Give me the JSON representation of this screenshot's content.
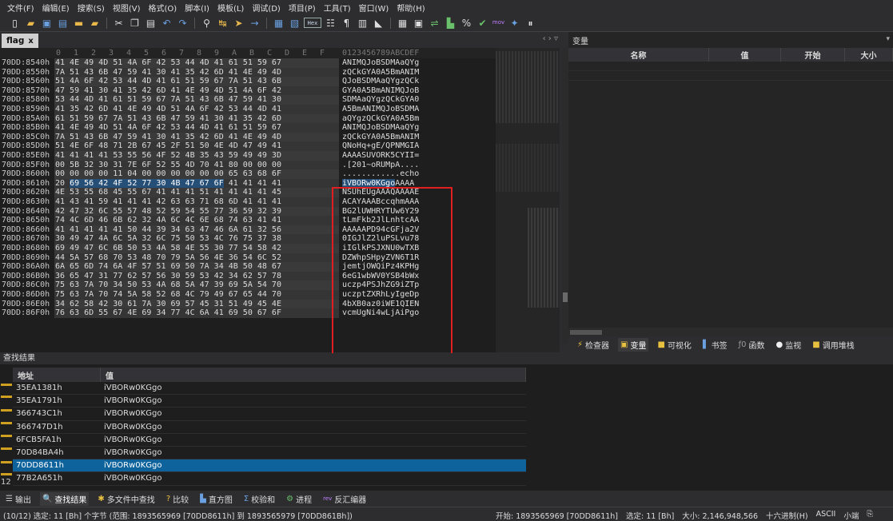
{
  "menu": [
    "文件(F)",
    "编辑(E)",
    "搜索(S)",
    "视图(V)",
    "格式(O)",
    "脚本(I)",
    "模板(L)",
    "调试(D)",
    "项目(P)",
    "工具(T)",
    "窗口(W)",
    "帮助(H)"
  ],
  "toolbar": {
    "hex_label": "Hex",
    "mov_label": "mov"
  },
  "tab": {
    "name": "flag",
    "close": "x"
  },
  "hex": {
    "header_cols": [
      "0",
      "1",
      "2",
      "3",
      "4",
      "5",
      "6",
      "7",
      "8",
      "9",
      "A",
      "B",
      "C",
      "D",
      "E",
      "F"
    ],
    "header_ascii": "0123456789ABCDEF",
    "rows": [
      {
        "off": "70DD:8540h",
        "hex": "41 4E 49 4D 51 4A 6F 42 53 44 4D 41 61 51 59 67",
        "ascii": "ANIMQJoBSDMAaQYg"
      },
      {
        "off": "70DD:8550h",
        "hex": "7A 51 43 6B 47 59 41 30 41 35 42 6D 41 4E 49 4D",
        "ascii": "zQCkGYA0A5BmANIM"
      },
      {
        "off": "70DD:8560h",
        "hex": "51 4A 6F 42 53 44 4D 41 61 51 59 67 7A 51 43 6B",
        "ascii": "QJoBSDMAaQYgzQCk"
      },
      {
        "off": "70DD:8570h",
        "hex": "47 59 41 30 41 35 42 6D 41 4E 49 4D 51 4A 6F 42",
        "ascii": "GYA0A5BmANIMQJoB"
      },
      {
        "off": "70DD:8580h",
        "hex": "53 44 4D 41 61 51 59 67 7A 51 43 6B 47 59 41 30",
        "ascii": "SDMAaQYgzQCkGYA0"
      },
      {
        "off": "70DD:8590h",
        "hex": "41 35 42 6D 41 4E 49 4D 51 4A 6F 42 53 44 4D 41",
        "ascii": "A5BmANIMQJoBSDMA"
      },
      {
        "off": "70DD:85A0h",
        "hex": "61 51 59 67 7A 51 43 6B 47 59 41 30 41 35 42 6D",
        "ascii": "aQYgzQCkGYA0A5Bm"
      },
      {
        "off": "70DD:85B0h",
        "hex": "41 4E 49 4D 51 4A 6F 42 53 44 4D 41 61 51 59 67",
        "ascii": "ANIMQJoBSDMAaQYg"
      },
      {
        "off": "70DD:85C0h",
        "hex": "7A 51 43 6B 47 59 41 30 41 35 42 6D 41 4E 49 4D",
        "ascii": "zQCkGYA0A5BmANIM"
      },
      {
        "off": "70DD:85D0h",
        "hex": "51 4E 6F 48 71 2B 67 45 2F 51 50 4E 4D 47 49 41",
        "ascii": "QNoHq+gE/QPNMGIA"
      },
      {
        "off": "70DD:85E0h",
        "hex": "41 41 41 41 53 55 56 4F 52 4B 35 43 59 49 49 3D",
        "ascii": "AAAASUVORK5CYII="
      },
      {
        "off": "70DD:85F0h",
        "hex": "00 5B 32 30 31 7E 6F 52 55 4D 70 41 80 00 00 00",
        "ascii": ".[201~oRUMpA...."
      },
      {
        "off": "70DD:8600h",
        "hex": "00 00 00 00 11 04 00 00 00 00 00 00 65 63 68 6F",
        "ascii": "............echo"
      },
      {
        "off": "70DD:8610h",
        "hex": "20 69 56 42 4F 52 77 30 4B 47 67 6F 41 41 41 41",
        "ascii": " iVBORw0KGgoAAAA",
        "hl": true
      },
      {
        "off": "70DD:8620h",
        "hex": "4E 53 55 68 45 55 67 41 41 41 51 41 41 41 41 45",
        "ascii": "NSUhEUgAAAQAAAAE"
      },
      {
        "off": "70DD:8630h",
        "hex": "41 43 41 59 41 41 41 42 63 63 71 68 6D 41 41 41",
        "ascii": "ACAYAAABccqhmAAA"
      },
      {
        "off": "70DD:8640h",
        "hex": "42 47 32 6C 55 57 48 52 59 54 55 77 36 59 32 39",
        "ascii": "BG2lUWHRYTUw6Y29"
      },
      {
        "off": "70DD:8650h",
        "hex": "74 4C 6D 46 6B 62 32 4A 6C 4C 6E 68 74 63 41 41",
        "ascii": "tLmFkb2JlLnhtcAA"
      },
      {
        "off": "70DD:8660h",
        "hex": "41 41 41 41 41 50 44 39 34 63 47 46 6A 61 32 56",
        "ascii": "AAAAAPD94cGFja2V"
      },
      {
        "off": "70DD:8670h",
        "hex": "30 49 47 4A 6C 5A 32 6C 75 50 53 4C 76 75 37 38",
        "ascii": "0IGJlZ2luPSLvu78"
      },
      {
        "off": "70DD:8680h",
        "hex": "69 49 47 6C 6B 50 53 4A 58 4E 55 30 77 54 58 42",
        "ascii": "iIGlkPSJXNU0wTXB"
      },
      {
        "off": "70DD:8690h",
        "hex": "44 5A 57 68 70 53 48 70 79 5A 56 4E 36 54 6C 52",
        "ascii": "DZWhpSHpyZVN6T1R"
      },
      {
        "off": "70DD:86A0h",
        "hex": "6A 65 6D 74 6A 4F 57 51 69 50 7A 34 4B 50 48 67",
        "ascii": "jemtjOWQiPz4KPHg"
      },
      {
        "off": "70DD:86B0h",
        "hex": "36 65 47 31 77 62 57 56 30 59 53 42 34 62 57 78",
        "ascii": "6eG1wbWV0YSB4bWx"
      },
      {
        "off": "70DD:86C0h",
        "hex": "75 63 7A 70 34 50 53 4A 68 5A 47 39 69 5A 54 70",
        "ascii": "uczp4PSJhZG9iZTp"
      },
      {
        "off": "70DD:86D0h",
        "hex": "75 63 7A 70 74 5A 58 52 68 4C 79 49 67 65 44 70",
        "ascii": "uczptZXRhLyIgeDp"
      },
      {
        "off": "70DD:86E0h",
        "hex": "34 62 58 42 30 61 7A 30 69 57 45 31 51 49 45 4E",
        "ascii": "4bXB0az0iWE1QIEN"
      },
      {
        "off": "70DD:86F0h",
        "hex": "76 63 6D 55 67 4E 69 34 77 4C 6A 41 69 50 67 6F",
        "ascii": "vcmUgNi4wLjAiPgo"
      }
    ]
  },
  "right_panel": {
    "title": "变量",
    "columns": [
      "名称",
      "值",
      "开始",
      "大小"
    ],
    "tabs": [
      "检查器",
      "变量",
      "可视化",
      "书签",
      "函数",
      "监视",
      "调用堆栈"
    ],
    "tab_icons": [
      "⚡",
      "▣",
      "■",
      "▌",
      "ƒ0",
      "●",
      "■"
    ]
  },
  "find": {
    "title": "查找结果",
    "columns": [
      "地址",
      "值"
    ],
    "rows": [
      {
        "addr": "35EA1381h",
        "val": "iVBORw0KGgo"
      },
      {
        "addr": "35EA1791h",
        "val": "iVBORw0KGgo"
      },
      {
        "addr": "366743C1h",
        "val": "iVBORw0KGgo"
      },
      {
        "addr": "366747D1h",
        "val": "iVBORw0KGgo"
      },
      {
        "addr": "6FCB5FA1h",
        "val": "iVBORw0KGgo"
      },
      {
        "addr": "70D84BA4h",
        "val": "iVBORw0KGgo"
      },
      {
        "addr": "70DD8611h",
        "val": "iVBORw0KGgo",
        "selected": true
      },
      {
        "addr": "77B2A651h",
        "val": "iVBORw0KGgo"
      }
    ],
    "count": "12"
  },
  "bottom_tabs": [
    "输出",
    "查找结果",
    "多文件中查找",
    "比较",
    "直方图",
    "校验和",
    "进程",
    "反汇编器"
  ],
  "bottom_tab_icons": [
    "☰",
    "🔍",
    "✱",
    "?",
    "▙",
    "Σ",
    "⚙",
    "rev"
  ],
  "status": {
    "left": "(10/12) 选定: 11 [Bh] 个字节 (范围: 1893565969 [70DD8611h] 到 1893565979 [70DD861Bh])",
    "start": "开始: 1893565969 [70DD8611h]",
    "sel": "选定: 11 [Bh]",
    "size": "大小: 2,146,948,566",
    "mode": "十六进制(H)",
    "charset": "ASCII",
    "endian": "小端"
  }
}
